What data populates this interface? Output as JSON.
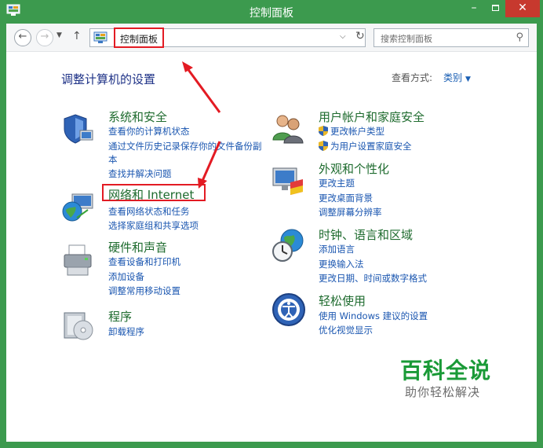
{
  "window": {
    "title": "控制面板",
    "accent_color": "#3c9a4e",
    "close_color": "#c7392e",
    "min_glyph": "–",
    "close_glyph": "✕"
  },
  "navbar": {
    "back_glyph": "←",
    "forward_glyph": "→",
    "recent_glyph": "▼",
    "up_glyph": "↑",
    "address_crumb": "控制面板",
    "dropdown_glyph": "⌵",
    "refresh_glyph": "↻",
    "search_placeholder": "搜索控制面板",
    "search_glyph": "⚲"
  },
  "main": {
    "heading": "调整计算机的设置",
    "view_by_label": "查看方式:",
    "view_by_value": "类别",
    "view_by_arrow": "▼"
  },
  "categories_left": [
    {
      "icon": "security-shield-icon",
      "title": "系统和安全",
      "links": [
        "查看你的计算机状态",
        "通过文件历史记录保存你的文件备份副",
        "本",
        "查找并解决问题"
      ]
    },
    {
      "icon": "network-globe-icon",
      "title": "网络和 Internet",
      "links": [
        "查看网络状态和任务",
        "选择家庭组和共享选项"
      ]
    },
    {
      "icon": "printer-icon",
      "title": "硬件和声音",
      "links": [
        "查看设备和打印机",
        "添加设备",
        "调整常用移动设置"
      ]
    },
    {
      "icon": "programs-disc-icon",
      "title": "程序",
      "links": [
        "卸载程序"
      ]
    }
  ],
  "categories_right": [
    {
      "icon": "users-icon",
      "title": "用户帐户和家庭安全",
      "links": [
        "更改帐户类型",
        "为用户设置家庭安全"
      ]
    },
    {
      "icon": "appearance-monitor-icon",
      "title": "外观和个性化",
      "links": [
        "更改主题",
        "更改桌面背景",
        "调整屏幕分辨率"
      ]
    },
    {
      "icon": "clock-globe-icon",
      "title": "时钟、语言和区域",
      "links": [
        "添加语言",
        "更换输入法",
        "更改日期、时间或数字格式"
      ]
    },
    {
      "icon": "ease-of-access-icon",
      "title": "轻松使用",
      "links": [
        "使用 Windows 建议的设置",
        "优化视觉显示"
      ]
    }
  ],
  "watermark": {
    "big": "百科全说",
    "small": "助你轻松解决"
  }
}
